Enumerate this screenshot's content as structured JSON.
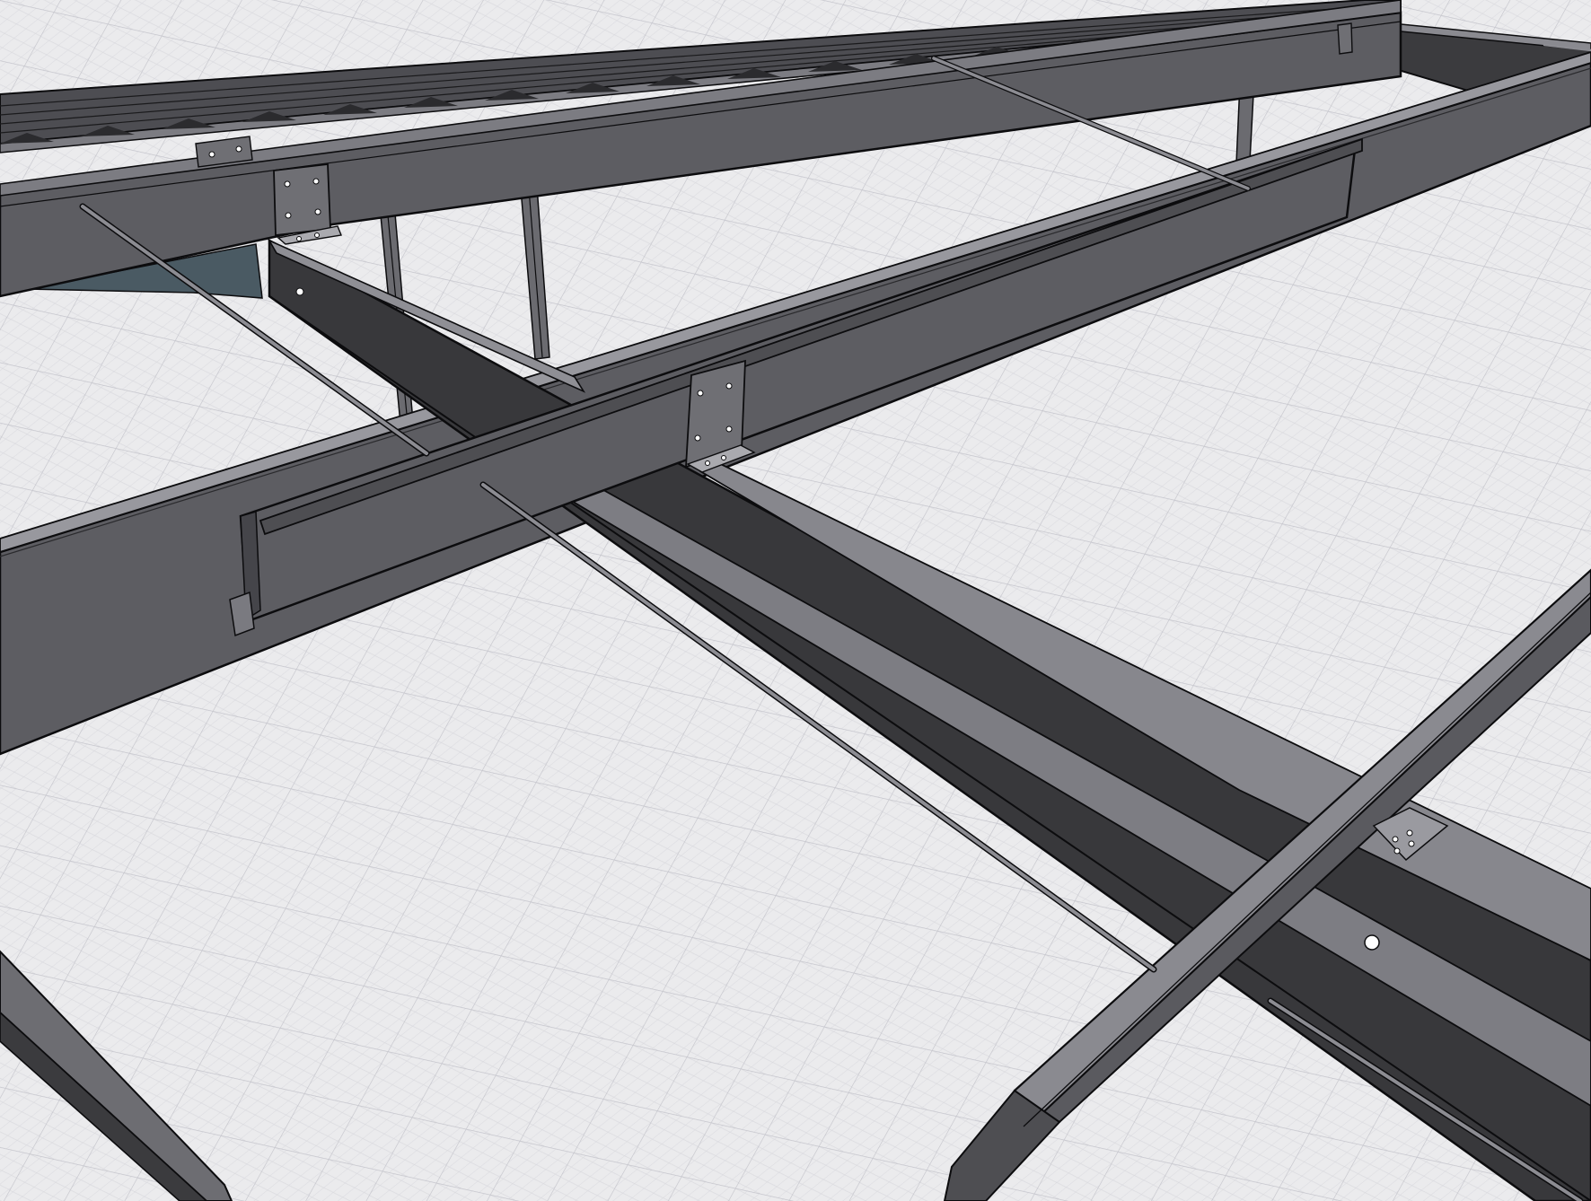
{
  "viewport": {
    "background": "#ebebed",
    "grid_minor_color": "#d7d7dc",
    "grid_major_color": "#c4c4cb"
  },
  "colors": {
    "steel_face": "#5d5d62",
    "steel_face_light": "#87878d",
    "steel_face_dark": "#3b3b3e",
    "steel_top": "#98989e",
    "gusset": "#4a5a63",
    "outline": "#0c0c0e",
    "rod": "#8c8c92",
    "bolt_hole": "#ffffff"
  },
  "members": [
    "roof-deck",
    "front-eave-beam",
    "rear-beam",
    "primary-girder",
    "cross-beam",
    "purlin",
    "lower-cross-member",
    "lower-left-member",
    "post-left",
    "post-right",
    "tie-rod-front",
    "tie-rod-middle",
    "tie-rod-back",
    "tie-rod-stub"
  ]
}
